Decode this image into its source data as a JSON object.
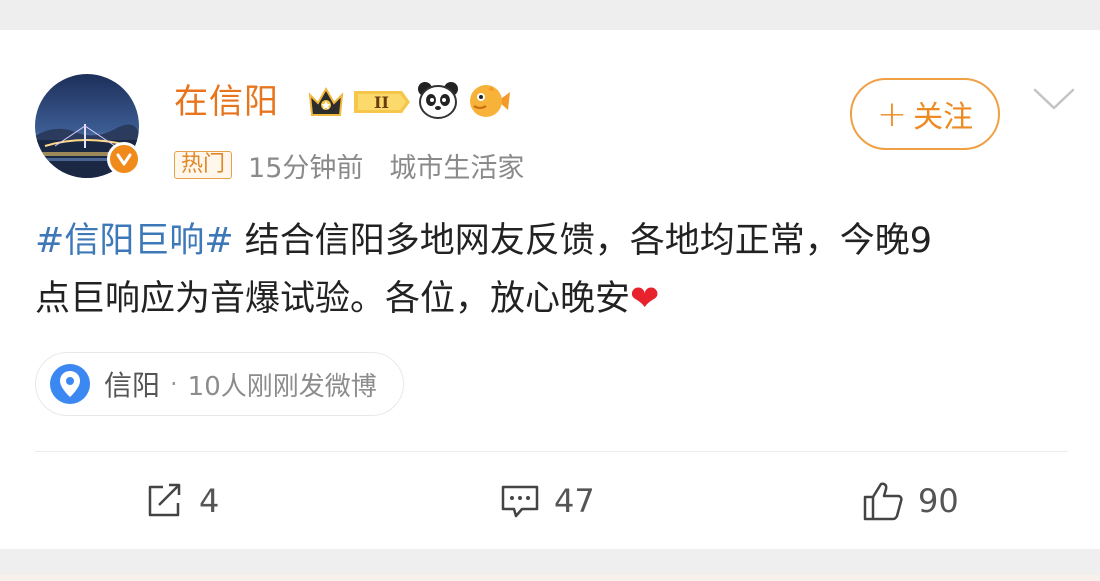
{
  "post": {
    "username": "在信阳",
    "hot_tag": "热门",
    "time": "15分钟前",
    "category": "城市生活家",
    "follow_label": "关注",
    "hashtag": "#信阳巨响#",
    "body_line1": "结合信阳多地网友反馈，各地均正常，今晚9",
    "body_line2": "点巨响应为音爆试验。各位，放心晚安",
    "location": {
      "name": "信阳",
      "separator": "·",
      "extra": "10人刚刚发微博"
    },
    "actions": {
      "repost_count": "4",
      "comment_count": "47",
      "like_count": "90"
    },
    "badges": {
      "crown_level": "II"
    }
  },
  "icons": [
    "verified-icon",
    "crown-badge-icon",
    "panda-icon",
    "fish-icon",
    "chevron-down-icon",
    "location-pin-icon",
    "repost-icon",
    "comment-icon",
    "like-icon",
    "heart-emoji-icon"
  ],
  "colors": {
    "username": "#e8741c",
    "hashtag": "#3d78b8",
    "follow": "#ee8a22",
    "pin": "#3b88f2"
  }
}
